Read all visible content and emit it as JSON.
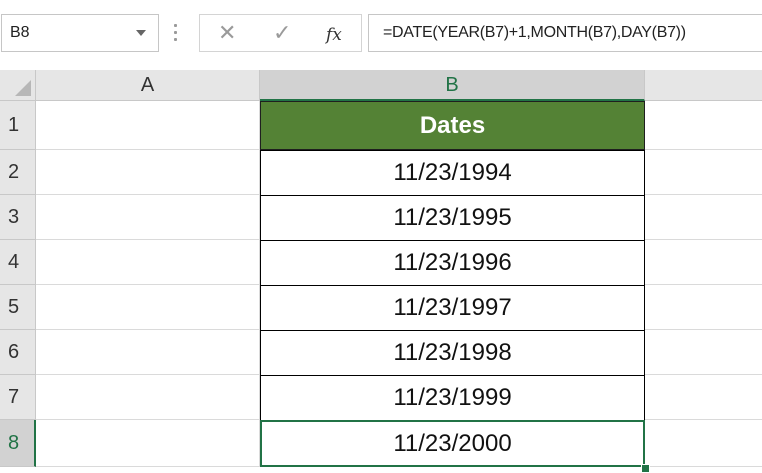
{
  "formula_bar": {
    "name_box": "B8",
    "cancel_icon": "✕",
    "enter_icon": "✓",
    "fx_icon": "fx",
    "formula": "=DATE(YEAR(B7)+1,MONTH(B7),DAY(B7))"
  },
  "columns": [
    "A",
    "B"
  ],
  "rows": [
    "1",
    "2",
    "3",
    "4",
    "5",
    "6",
    "7",
    "8"
  ],
  "cells": {
    "B1": "Dates",
    "B2": "11/23/1994",
    "B3": "11/23/1995",
    "B4": "11/23/1996",
    "B5": "11/23/1997",
    "B6": "11/23/1998",
    "B7": "11/23/1999",
    "B8": "11/23/2000"
  },
  "colors": {
    "header_fill": "#548235",
    "selection": "#217346"
  }
}
